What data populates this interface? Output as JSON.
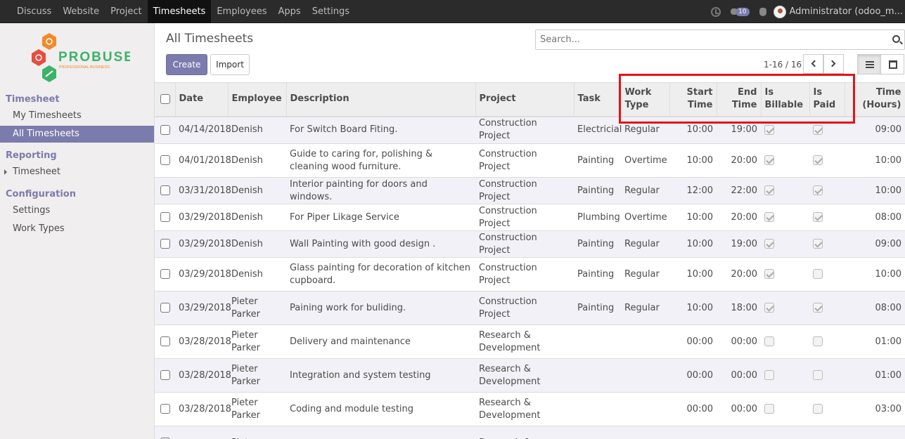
{
  "topbar": {
    "menu": [
      "Discuss",
      "Website",
      "Project",
      "Timesheets",
      "Employees",
      "Apps",
      "Settings"
    ],
    "active_index": 3,
    "chat_count": "10",
    "user": "Administrator (odoo_m..."
  },
  "sidebar": {
    "logo_text": "PROBUSE",
    "logo_tagline": "PROFESSIONAL BUSINESS",
    "sections": [
      {
        "title": "Timesheet",
        "items": [
          "My Timesheets",
          "All Timesheets"
        ]
      },
      {
        "title": "Reporting",
        "items": [
          "Timesheet"
        ]
      },
      {
        "title": "Configuration",
        "items": [
          "Settings",
          "Work Types"
        ]
      }
    ],
    "active_item": "All Timesheets"
  },
  "control": {
    "title": "All Timesheets",
    "create_label": "Create",
    "import_label": "Import",
    "search_placeholder": "Search...",
    "pager": "1-16 / 16"
  },
  "table": {
    "columns": [
      "Date",
      "Employee",
      "Description",
      "Project",
      "Task",
      "Work Type",
      "Start Time",
      "End Time",
      "Is Billable",
      "Is Paid",
      "Time (Hours)"
    ],
    "rows": [
      {
        "date": "04/14/2018",
        "employee": "Denish",
        "description": "For Switch Board Fiting.",
        "project": "Construction Project",
        "task": "Electricial",
        "work_type": "Regular",
        "start": "10:00",
        "end": "19:00",
        "billable": true,
        "paid": true,
        "hours": "09:00"
      },
      {
        "date": "04/01/2018",
        "employee": "Denish",
        "description": "Guide to caring for, polishing & cleaning wood furniture.",
        "project": "Construction Project",
        "task": "Painting",
        "work_type": "Overtime",
        "start": "10:00",
        "end": "20:00",
        "billable": true,
        "paid": true,
        "hours": "10:00"
      },
      {
        "date": "03/31/2018",
        "employee": "Denish",
        "description": "Interior painting for doors and windows.",
        "project": "Construction Project",
        "task": "Painting",
        "work_type": "Regular",
        "start": "12:00",
        "end": "22:00",
        "billable": true,
        "paid": true,
        "hours": "10:00"
      },
      {
        "date": "03/29/2018",
        "employee": "Denish",
        "description": "For Piper Likage Service",
        "project": "Construction Project",
        "task": "Plumbing",
        "work_type": "Overtime",
        "start": "10:00",
        "end": "20:00",
        "billable": true,
        "paid": true,
        "hours": "08:00"
      },
      {
        "date": "03/29/2018",
        "employee": "Denish",
        "description": "Wall Painting with good design .",
        "project": "Construction Project",
        "task": "Painting",
        "work_type": "Regular",
        "start": "10:00",
        "end": "19:00",
        "billable": true,
        "paid": true,
        "hours": "09:00"
      },
      {
        "date": "03/29/2018",
        "employee": "Denish",
        "description": "Glass painting for decoration of kitchen cupboard.",
        "project": "Construction Project",
        "task": "Painting",
        "work_type": "Regular",
        "start": "10:00",
        "end": "20:00",
        "billable": true,
        "paid": false,
        "hours": "10:00"
      },
      {
        "date": "03/29/2018",
        "employee": "Pieter Parker",
        "description": "Paining work for buliding.",
        "project": "Construction Project",
        "task": "Painting",
        "work_type": "Regular",
        "start": "10:00",
        "end": "18:00",
        "billable": true,
        "paid": true,
        "hours": "08:00"
      },
      {
        "date": "03/28/2018",
        "employee": "Pieter Parker",
        "description": "Delivery and maintenance",
        "project": "Research & Development",
        "task": "",
        "work_type": "",
        "start": "00:00",
        "end": "00:00",
        "billable": false,
        "paid": false,
        "hours": "01:00"
      },
      {
        "date": "03/28/2018",
        "employee": "Pieter Parker",
        "description": "Integration and system testing",
        "project": "Research & Development",
        "task": "",
        "work_type": "",
        "start": "00:00",
        "end": "00:00",
        "billable": false,
        "paid": false,
        "hours": "01:00"
      },
      {
        "date": "03/28/2018",
        "employee": "Pieter Parker",
        "description": "Coding and module testing",
        "project": "Research & Development",
        "task": "",
        "work_type": "",
        "start": "00:00",
        "end": "00:00",
        "billable": false,
        "paid": false,
        "hours": "03:00"
      },
      {
        "date": "",
        "employee": "Pieter",
        "description": "",
        "project": "Research &",
        "task": "",
        "work_type": "",
        "start": "",
        "end": "",
        "billable": false,
        "paid": false,
        "hours": ""
      }
    ]
  },
  "colors": {
    "brand": "#7c7bad",
    "highlight": "#e3131b",
    "navbar": "#2b2b2b"
  }
}
